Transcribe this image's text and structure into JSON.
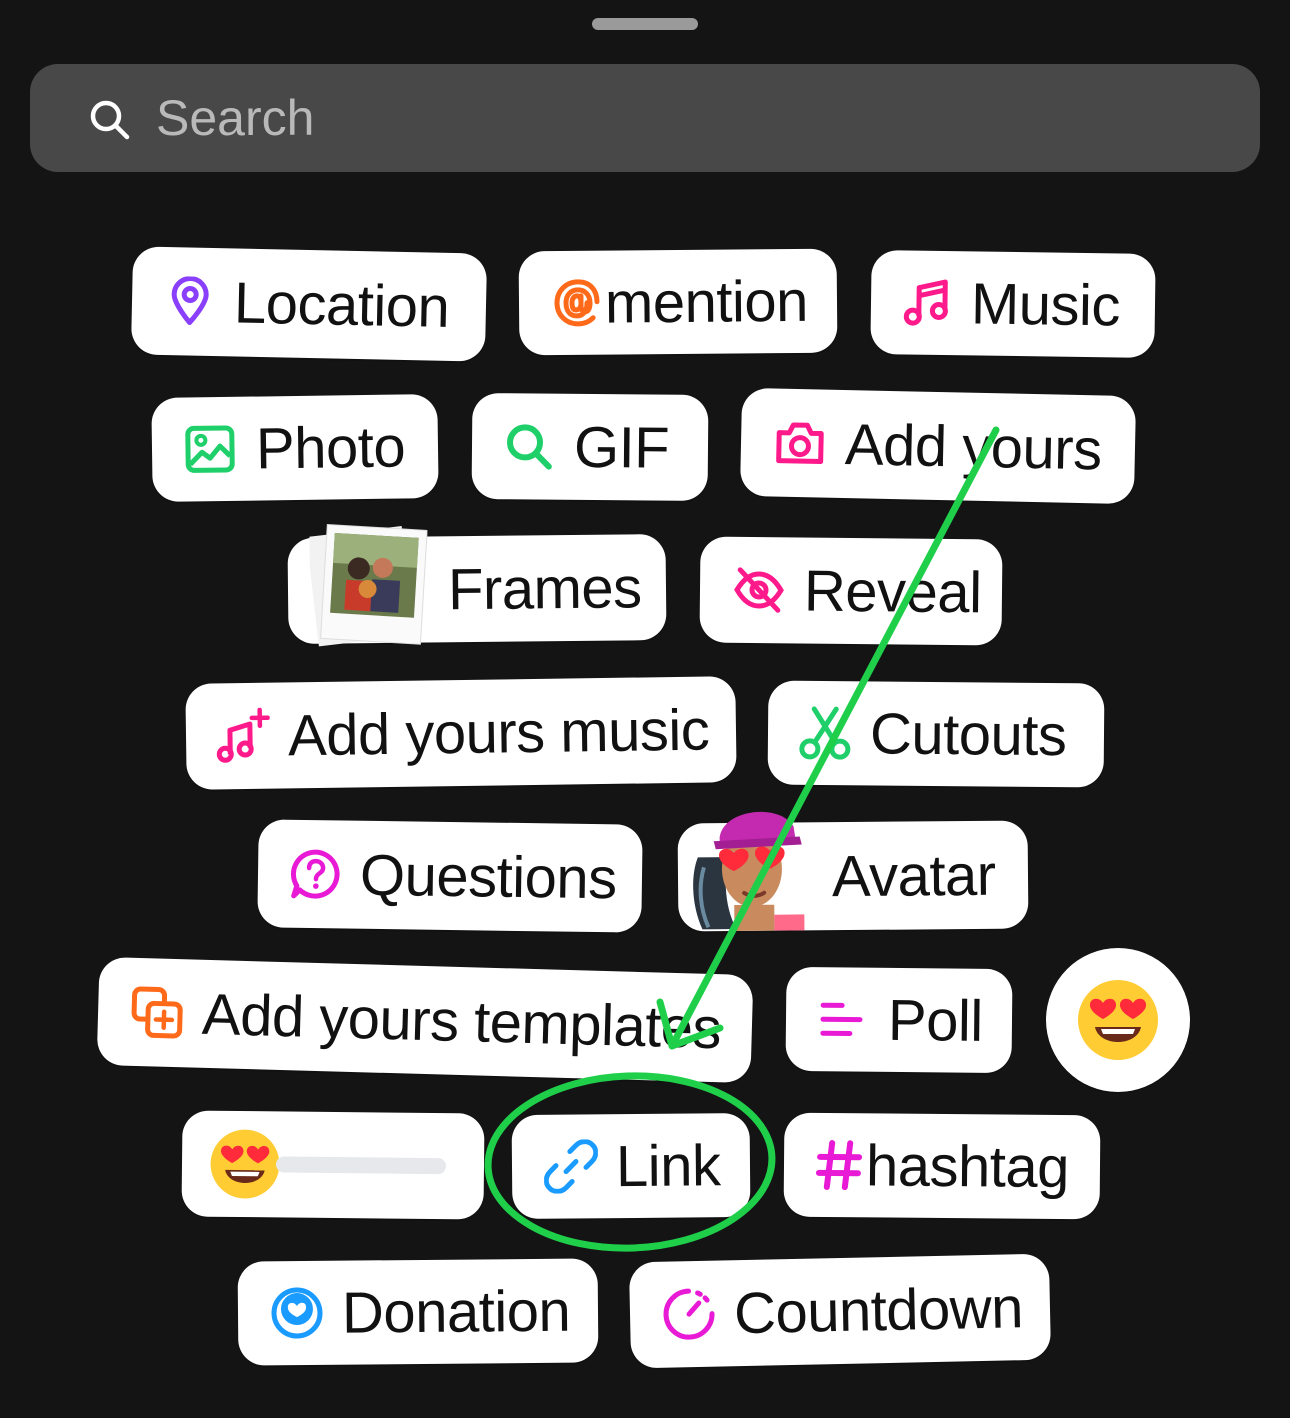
{
  "search": {
    "placeholder": "Search"
  },
  "stickers": {
    "location": "Location",
    "mention": "mention",
    "music": "Music",
    "photo": "Photo",
    "gif": "GIF",
    "add_yours": "Add yours",
    "frames": "Frames",
    "reveal": "Reveal",
    "add_yours_music": "Add yours music",
    "cutouts": "Cutouts",
    "questions": "Questions",
    "avatar": "Avatar",
    "add_yours_templates": "Add yours templates",
    "poll": "Poll",
    "link": "Link",
    "hashtag": "hashtag",
    "donation": "Donation",
    "countdown": "Countdown"
  },
  "emoji_slider_value": 0.0,
  "colors": {
    "location": "#8a3ffc",
    "mention": "#ff6a1a",
    "music": "#ff1a8c",
    "photo": "#1fcf6a",
    "gif": "#1fcf6a",
    "add_yours": "#ff1a8c",
    "reveal": "#ff1a8c",
    "cutouts": "#1fcf6a",
    "questions": "#e91ad6",
    "templates": "#ff6a1a",
    "poll": "#e91ad6",
    "link": "#1a9bff",
    "hashtag": "#e91ad6",
    "donation": "#1a9bff",
    "countdown": "#e91ad6",
    "annotation": "#1fcf4a"
  }
}
